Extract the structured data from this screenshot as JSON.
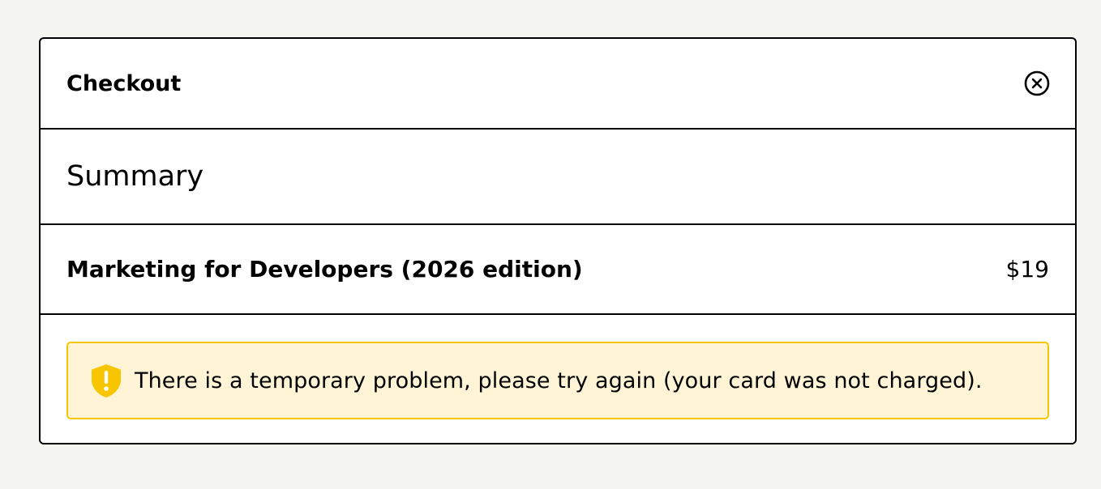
{
  "checkout": {
    "title": "Checkout",
    "close_icon": "close-circle-icon",
    "summary_heading": "Summary",
    "product": {
      "name": "Marketing for Developers (2026 edition)",
      "price": "$19"
    },
    "alert": {
      "icon": "shield-warning-icon",
      "message": "There is a temporary problem, please try again (your card was not charged).",
      "colors": {
        "background": "#fff5d6",
        "border": "#f7c600",
        "icon": "#f7c600"
      }
    }
  }
}
